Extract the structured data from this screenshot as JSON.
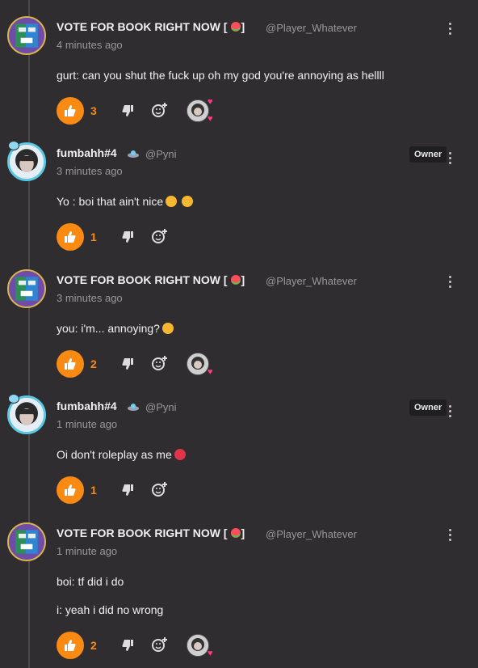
{
  "thread": {
    "comments": [
      {
        "author": "VOTE FOR BOOK RIGHT NOW [",
        "author_suffix": "]",
        "handle": "@Player_Whatever",
        "time": "4 minutes ago",
        "lines": [
          "gurt: can you shut the fuck up oh my god you're annoying as hellll"
        ],
        "likes": "3"
      },
      {
        "author": "fumbahh#4",
        "handle": "@Pyni",
        "time": "3 minutes ago",
        "lines": [
          "Yo : boi that ain't nice"
        ],
        "likes": "1",
        "owner_label": "Owner"
      },
      {
        "author": "VOTE FOR BOOK RIGHT NOW [",
        "author_suffix": "]",
        "handle": "@Player_Whatever",
        "time": "3 minutes ago",
        "lines": [
          "you: i'm... annoying?"
        ],
        "likes": "2"
      },
      {
        "author": "fumbahh#4",
        "handle": "@Pyni",
        "time": "1 minute ago",
        "lines": [
          "Oi don't roleplay as me"
        ],
        "likes": "1",
        "owner_label": "Owner"
      },
      {
        "author": "VOTE FOR BOOK RIGHT NOW [",
        "author_suffix": "]",
        "handle": "@Player_Whatever",
        "time": "1 minute ago",
        "lines": [
          "boi: tf did i do",
          "i: yeah i did no wrong"
        ],
        "likes": "2"
      }
    ]
  },
  "icons": {
    "like": "thumbs-up-icon",
    "dislike": "thumbs-down-icon",
    "react": "add-reaction-icon",
    "menu": "more-vertical-icon",
    "flag": "watermelon-icon",
    "heart": "heart-icon"
  },
  "colors": {
    "background": "#2f2d2f",
    "accent": "#fb8a13",
    "muted": "#9a979a",
    "heart": "#ff3b8a"
  }
}
